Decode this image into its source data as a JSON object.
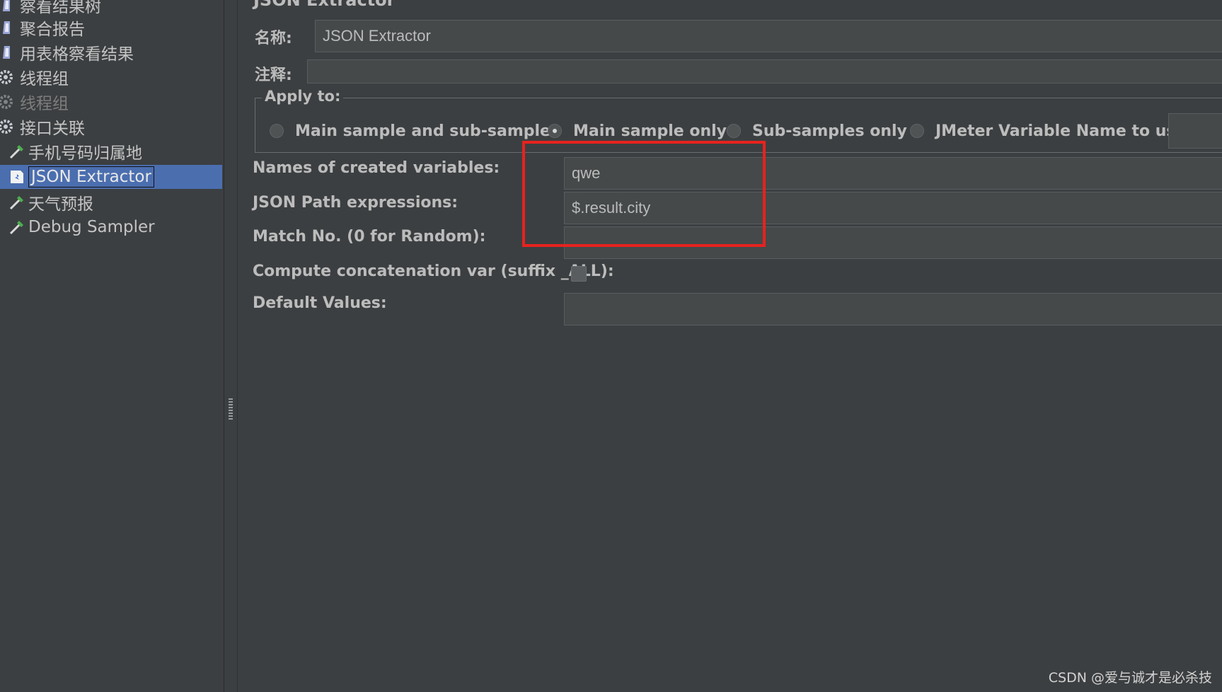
{
  "tree": {
    "items": [
      {
        "label": "察看结果树",
        "icon": "listener-icon"
      },
      {
        "label": "聚合报告",
        "icon": "listener-icon"
      },
      {
        "label": "用表格察看结果",
        "icon": "listener-icon"
      },
      {
        "label": "线程组",
        "icon": "gear-icon"
      },
      {
        "label": "线程组",
        "icon": "gear-icon"
      },
      {
        "label": "接口关联",
        "icon": "gear-icon"
      },
      {
        "label": "手机号码归属地",
        "icon": "sampler-pipette-icon"
      },
      {
        "label": "JSON Extractor",
        "icon": "post-processor-icon"
      },
      {
        "label": "天气预报",
        "icon": "sampler-pipette-icon"
      },
      {
        "label": "Debug Sampler",
        "icon": "sampler-pipette-icon"
      }
    ]
  },
  "panel": {
    "title": "JSON Extractor",
    "name_label": "名称:",
    "name_value": "JSON Extractor",
    "comment_label": "注释:",
    "comment_value": "",
    "apply_to": {
      "legend": "Apply to:",
      "options": [
        {
          "label": "Main sample and sub-samples",
          "selected": false
        },
        {
          "label": "Main sample only",
          "selected": true
        },
        {
          "label": "Sub-samples only",
          "selected": false
        },
        {
          "label": "JMeter Variable Name to use",
          "selected": false
        }
      ]
    },
    "fields": {
      "names_label": "Names of created variables:",
      "names_value": "qwe",
      "paths_label": "JSON Path expressions:",
      "paths_value": "$.result.city",
      "match_label": "Match No. (0 for Random):",
      "match_value": "",
      "concat_label": "Compute concatenation var (suffix _ALL):",
      "concat_checked": false,
      "default_label": "Default Values:",
      "default_value": ""
    }
  },
  "annotation": {
    "color": "#e8221e"
  },
  "watermark": "CSDN @爱与诚才是必杀技"
}
